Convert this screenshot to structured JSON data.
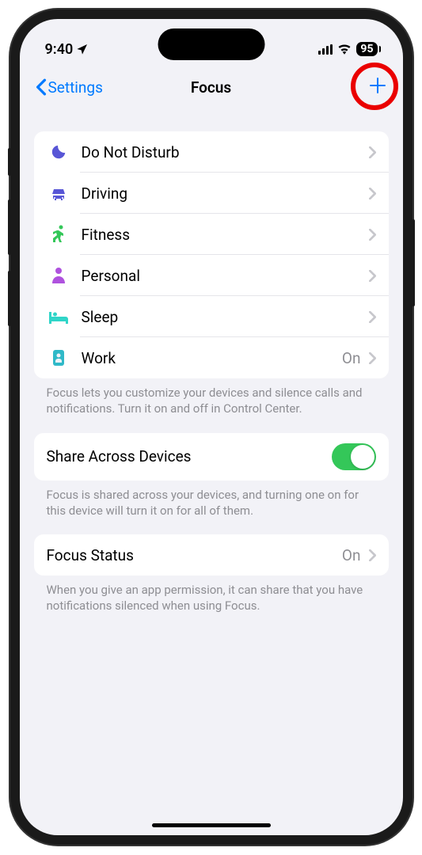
{
  "status_bar": {
    "time": "9:40",
    "battery": "95"
  },
  "nav": {
    "back_label": "Settings",
    "title": "Focus"
  },
  "focus_modes": [
    {
      "label": "Do Not Disturb",
      "value": "",
      "icon": "moon",
      "color": "#5856d6"
    },
    {
      "label": "Driving",
      "value": "",
      "icon": "car",
      "color": "#5856d6"
    },
    {
      "label": "Fitness",
      "value": "",
      "icon": "running",
      "color": "#34c759"
    },
    {
      "label": "Personal",
      "value": "",
      "icon": "person",
      "color": "#af52de"
    },
    {
      "label": "Sleep",
      "value": "",
      "icon": "bed",
      "color": "#30d5c8"
    },
    {
      "label": "Work",
      "value": "On",
      "icon": "badge",
      "color": "#30b9c8"
    }
  ],
  "focus_footer": "Focus lets you customize your devices and silence calls and notifications. Turn it on and off in Control Center.",
  "share": {
    "label": "Share Across Devices",
    "footer": "Focus is shared across your devices, and turning one on for this device will turn it on for all of them."
  },
  "focus_status": {
    "label": "Focus Status",
    "value": "On",
    "footer": "When you give an app permission, it can share that you have notifications silenced when using Focus."
  }
}
